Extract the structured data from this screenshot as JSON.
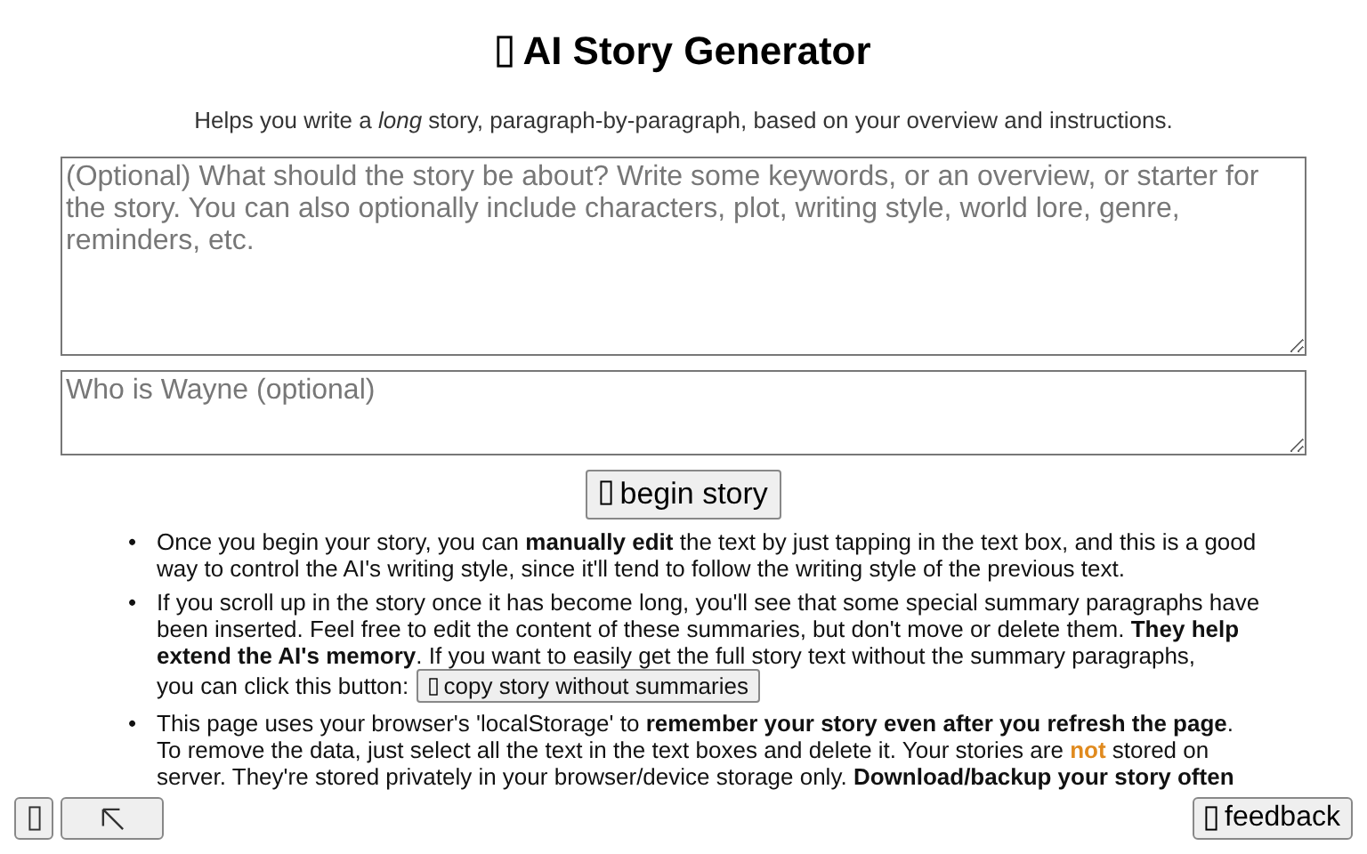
{
  "title": "AI Story Generator",
  "subtitle": "Helps you write a *long* story, paragraph-by-paragraph, based on your overview and instructions.",
  "overview_field": {
    "placeholder": "(Optional) What should the story be about? Write some keywords, or an overview, or starter for the story. You can also optionally include characters, plot, writing style, world lore, genre, reminders, etc."
  },
  "character_field": {
    "placeholder": "Who is Wayne (optional)"
  },
  "begin_button": "begin story",
  "tips": [
    {
      "marker": "•",
      "segments": [
        {
          "text": "Once you begin your story, you can **manually edit** the text by just tapping in the text box, and this is a good way to control the AI's writing style, since it'll tend to follow the writing style of the previous text.",
          "kind": "plain"
        }
      ]
    },
    {
      "marker": "•",
      "segments": [
        {
          "text": "If you scroll up in the story once it has become long, you'll see that some special summary paragraphs have been inserted. Feel free to edit the content of these summaries, but don't move or delete them. **They help extend the AI's memory**. If you want to easily get the full story text without the summary paragraphs,",
          "kind": "plain"
        }
      ],
      "button_prompt": "you can click this button:",
      "button": "copy story without summaries"
    },
    {
      "marker": "•",
      "segments": [
        {
          "text": "This page uses your browser's 'localStorage' to **remember your story even after you refresh the page**. To remove the data, just select all the text in the text boxes and delete it. Your stories are ",
          "kind": "plain"
        },
        {
          "text": "not",
          "kind": "warning"
        },
        {
          "text": " stored on server. They're stored privately in your browser/device storage only. **Download/backup your story often**",
          "kind": "plain"
        }
      ]
    }
  ],
  "feedback_button": "feedback"
}
